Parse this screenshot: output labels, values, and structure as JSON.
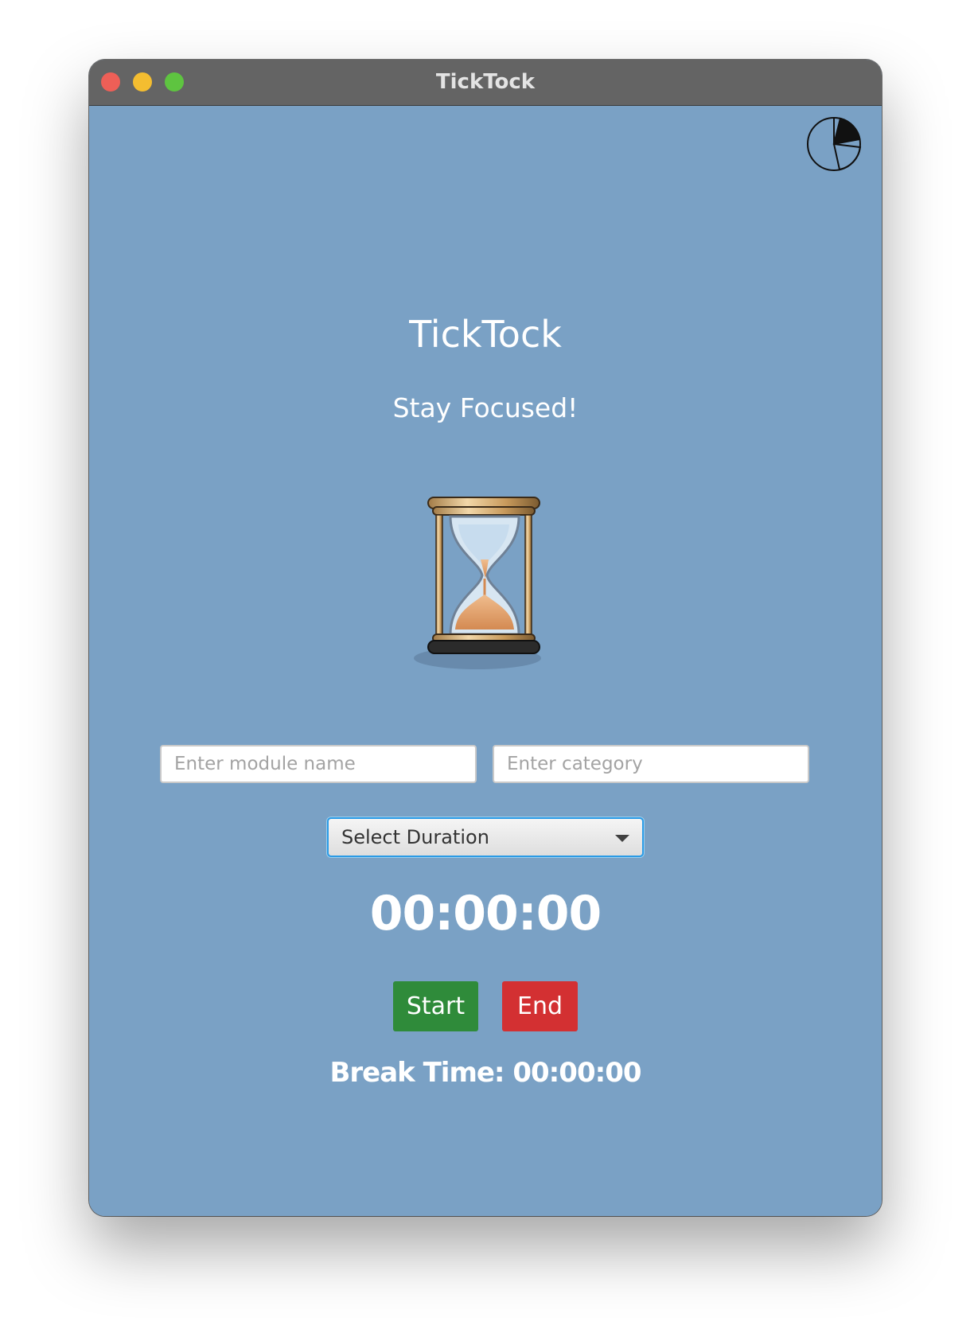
{
  "window": {
    "title": "TickTock"
  },
  "app": {
    "title": "TickTock",
    "subtitle": "Stay Focused!"
  },
  "icons": {
    "stats": "pie-chart-icon",
    "hero": "hourglass-icon"
  },
  "inputs": {
    "module_placeholder": "Enter module name",
    "module_value": "",
    "category_placeholder": "Enter category",
    "category_value": ""
  },
  "duration": {
    "selected": "Select Duration"
  },
  "timer": {
    "value": "00:00:00"
  },
  "buttons": {
    "start": "Start",
    "end": "End"
  },
  "break_time": {
    "text": "Break Time: 00:00:00"
  },
  "colors": {
    "background": "#7aa1c5",
    "titlebar": "#646464",
    "start": "#2f8b3a",
    "end": "#d33032",
    "focus_ring": "#2b9be6"
  }
}
